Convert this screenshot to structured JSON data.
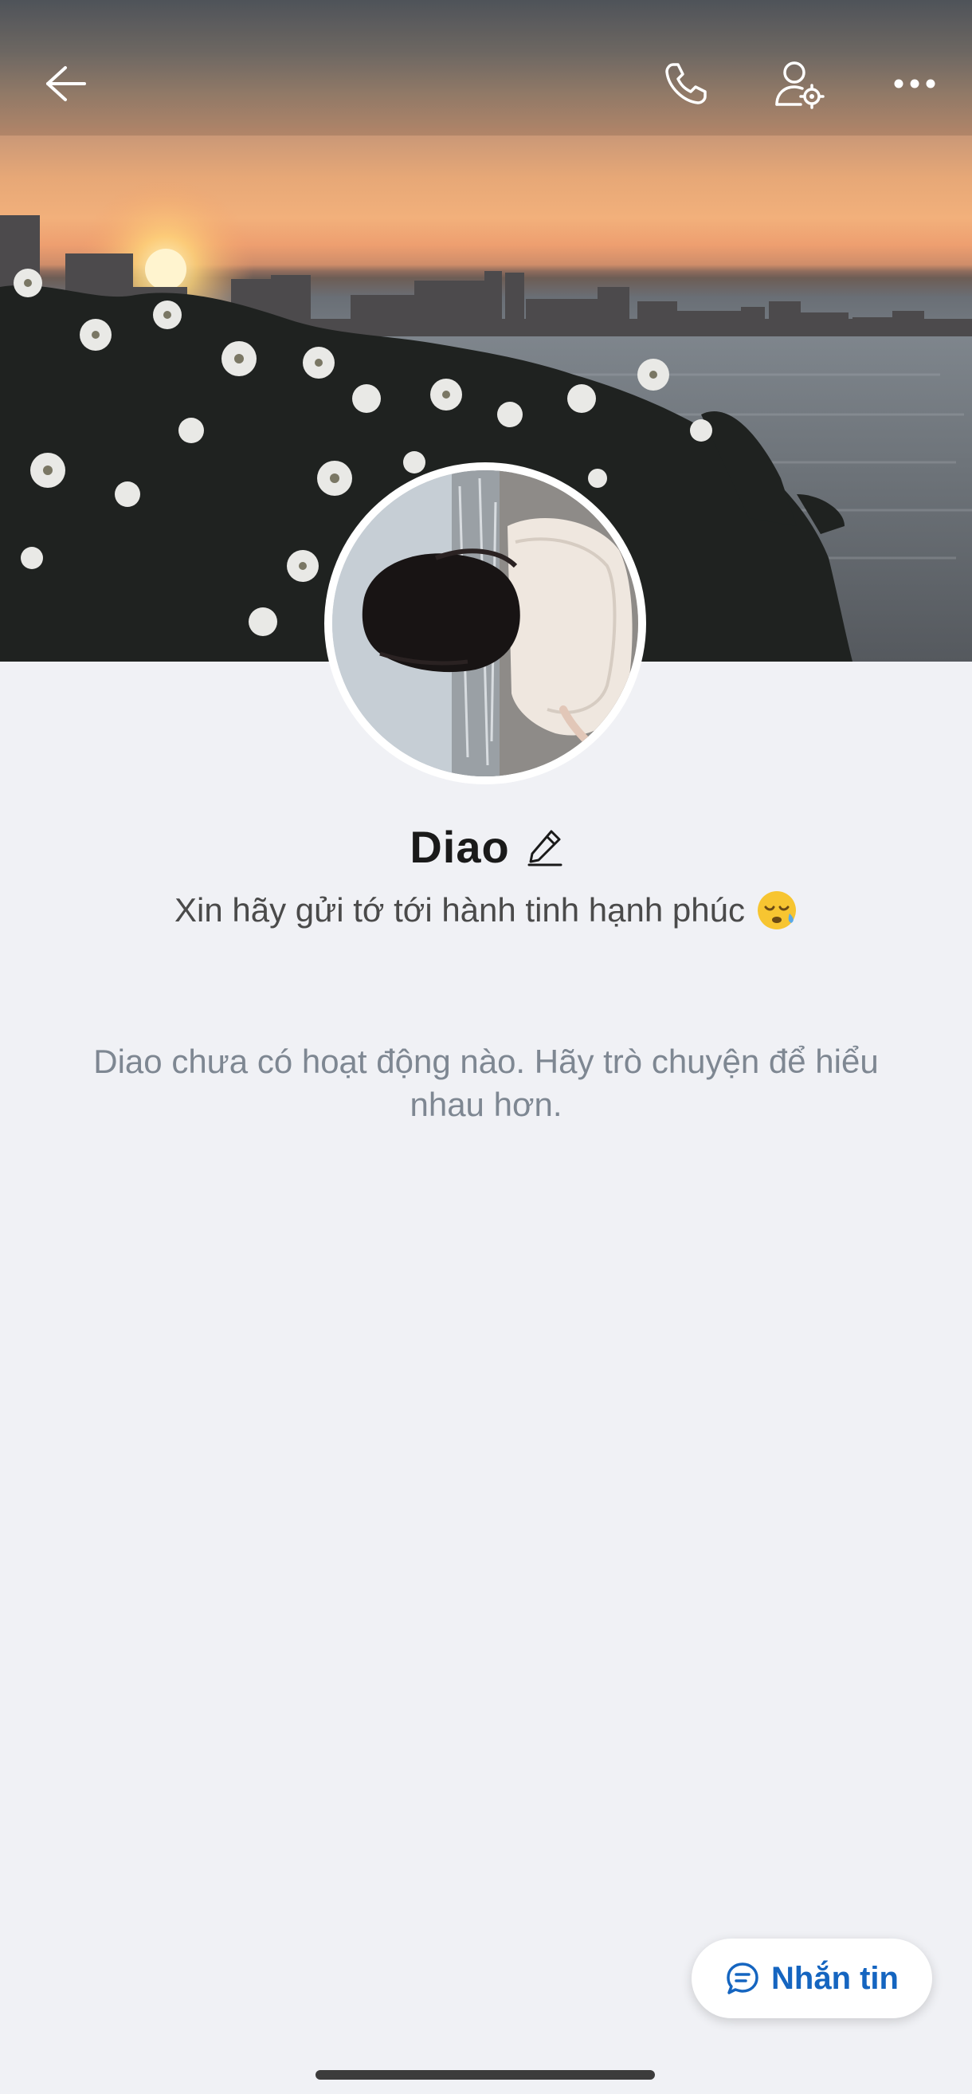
{
  "profile": {
    "name": "Diao",
    "bio": "Xin hãy gửi tớ tới hành tinh hạnh phúc",
    "bio_emoji": "sleepy-face-emoji"
  },
  "activity": {
    "empty_message": "Diao chưa có hoạt động nào. Hãy trò chuyện để hiểu nhau hơn."
  },
  "actions": {
    "message_label": "Nhắn tin"
  },
  "icons": {
    "back": "back-arrow-icon",
    "call": "phone-icon",
    "profile_settings": "user-settings-icon",
    "more": "more-dots-icon",
    "edit": "pencil-icon",
    "chat": "chat-bubble-icon"
  },
  "colors": {
    "background": "#f0f1f5",
    "accent": "#1565c0",
    "name_text": "#1a1a1a",
    "muted_text": "#7e8792"
  }
}
